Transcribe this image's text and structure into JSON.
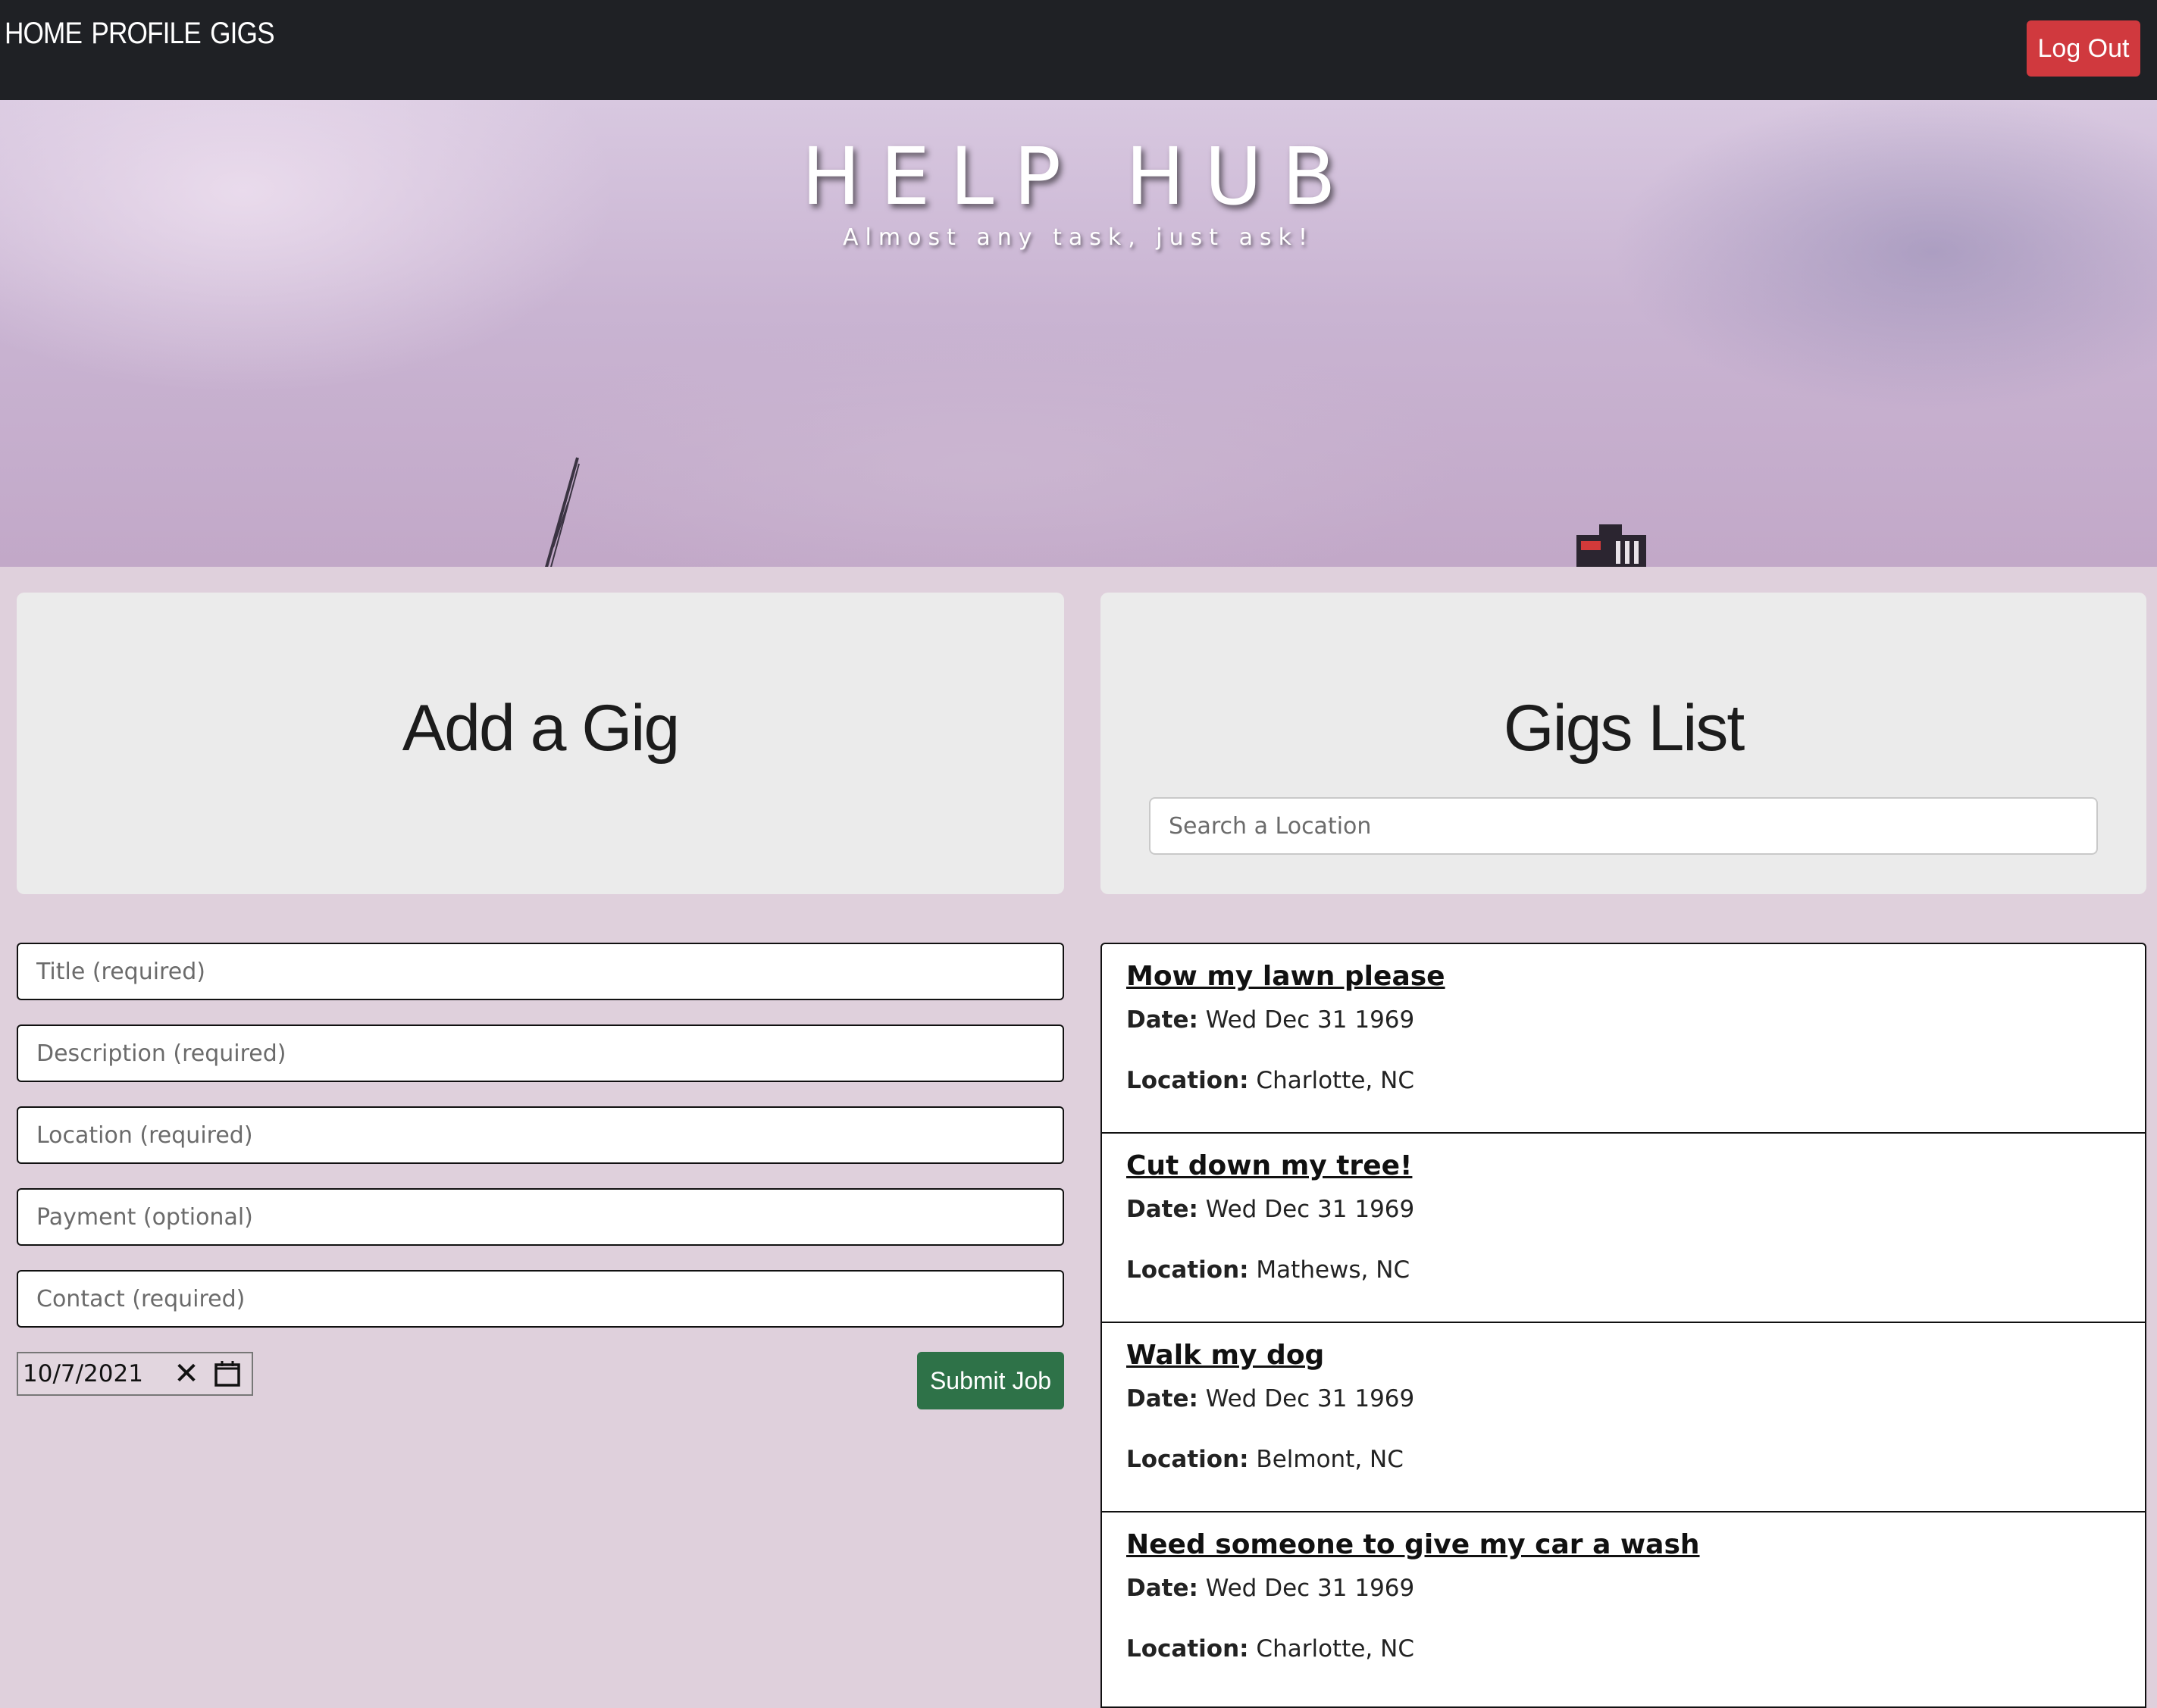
{
  "nav": {
    "links": [
      "HOME",
      "PROFILE",
      "GIGS"
    ],
    "logout_label": "Log Out"
  },
  "hero": {
    "title": "HELP HUB",
    "subtitle": "Almost any task, just ask!"
  },
  "add_gig": {
    "heading": "Add a Gig",
    "fields": {
      "title_placeholder": "Title (required)",
      "description_placeholder": "Description (required)",
      "location_placeholder": "Location (required)",
      "payment_placeholder": "Payment (optional)",
      "contact_placeholder": "Contact (required)"
    },
    "date_value": "10/7/2021",
    "submit_label": "Submit Job"
  },
  "gigs_list": {
    "heading": "Gigs List",
    "search_placeholder": "Search a Location",
    "date_label": "Date:",
    "location_label": "Location:",
    "items": [
      {
        "title": "Mow my lawn please",
        "date": "Wed Dec 31 1969",
        "location": "Charlotte, NC"
      },
      {
        "title": "Cut down my tree!",
        "date": "Wed Dec 31 1969",
        "location": "Mathews, NC"
      },
      {
        "title": "Walk my dog",
        "date": "Wed Dec 31 1969",
        "location": "Belmont, NC"
      },
      {
        "title": "Need someone to give my car a wash",
        "date": "Wed Dec 31 1969",
        "location": "Charlotte, NC"
      }
    ]
  },
  "icons": {
    "date_clear": "close-icon",
    "date_picker": "calendar-icon"
  },
  "colors": {
    "navbar_bg": "#1f2125",
    "logout_bg": "#d0393e",
    "submit_bg": "#2e7248",
    "page_bg": "#dfd0dc"
  }
}
